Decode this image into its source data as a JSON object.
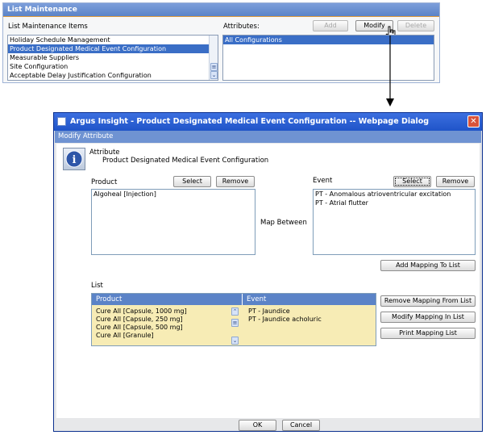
{
  "list_maintenance": {
    "title": "List Maintenance",
    "items_label": "List Maintenance Items",
    "attributes_label": "Attributes:",
    "add_label": "Add",
    "modify_label": "Modify",
    "delete_label": "Delete",
    "items": [
      "Holiday Schedule Management",
      "Product Designated Medical Event Configuration",
      "Measurable Suppliers",
      "Site Configuration",
      "Acceptable Delay Justification Configuration"
    ],
    "selected_item_index": 1,
    "attributes": [
      "All Configurations"
    ]
  },
  "dialog": {
    "title": "Argus Insight - Product Designated Medical Event Configuration -- Webpage Dialog",
    "header": "Modify Attribute",
    "attribute_label": "Attribute",
    "attribute_value": "Product Designated Medical Event Configuration",
    "product_label": "Product",
    "event_label": "Event",
    "select_label": "Select",
    "remove_label": "Remove",
    "map_between_label": "Map Between",
    "product_items": [
      "Algoheal [Injection]"
    ],
    "event_items": [
      "PT - Anomalous atrioventricular excitation",
      "PT - Atrial flutter"
    ],
    "add_mapping_label": "Add Mapping To List",
    "list_label": "List",
    "list_headers": {
      "product": "Product",
      "event": "Event"
    },
    "list_products": [
      "Cure All [Capsule, 1000 mg]",
      "Cure All [Capsule, 250 mg]",
      "Cure All [Capsule, 500 mg]",
      "Cure All [Granule]"
    ],
    "list_events": [
      "PT - Jaundice",
      "PT - Jaundice acholuric"
    ],
    "remove_mapping_label": "Remove Mapping From List",
    "modify_mapping_label": "Modify Mapping In List",
    "print_mapping_label": "Print Mapping List",
    "ok_label": "OK",
    "cancel_label": "Cancel",
    "close_glyph": "✕"
  },
  "colors": {
    "header_blue": "#5b83c7",
    "dialog_title": "#1f54c8",
    "list_fill": "#f7ecb5",
    "selected": "#3a6ec6"
  }
}
